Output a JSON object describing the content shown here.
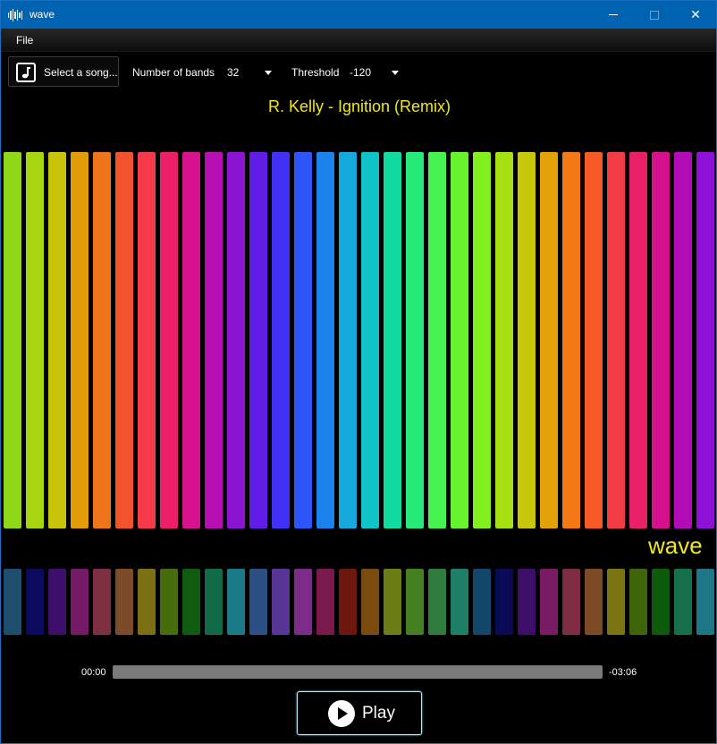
{
  "window": {
    "title": "wave"
  },
  "menu": {
    "file": "File"
  },
  "toolbar": {
    "select_song": "Select a song...",
    "bands_label": "Number of bands",
    "bands_value": "32",
    "threshold_label": "Threshold",
    "threshold_value": "-120"
  },
  "song_title": "R. Kelly - Ignition (Remix)",
  "logo": "wave",
  "playback": {
    "elapsed": "00:00",
    "remaining": "-03:06",
    "progress": 0
  },
  "play_label": "Play",
  "accent": "#f1e71a",
  "spectrum_top": [
    "#8fd719",
    "#a6d60f",
    "#c8c40a",
    "#e29c09",
    "#f0741a",
    "#f2522c",
    "#f53b4a",
    "#ec1f68",
    "#d8128c",
    "#b60fb4",
    "#8b14d2",
    "#611ce8",
    "#4230f4",
    "#2d55f7",
    "#1b82ee",
    "#15a9dd",
    "#10c3c6",
    "#12dba2",
    "#28ea78",
    "#47f44f",
    "#66f42e",
    "#84ef1f",
    "#a6df12",
    "#c8c70b",
    "#e3a10a",
    "#f37816",
    "#f65a27",
    "#f23c45",
    "#e82167",
    "#d4108d",
    "#b20cb7",
    "#8f10d6"
  ],
  "spectrum_bottom": [
    "#1d4e6e",
    "#0c0a5e",
    "#3d0f6a",
    "#751a66",
    "#7e2f43",
    "#7d4a2a",
    "#7c6f14",
    "#476c0c",
    "#0f5b10",
    "#116b49",
    "#1b7a87",
    "#2c4f86",
    "#573695",
    "#7b2b88",
    "#7a1a4c",
    "#6d170e",
    "#7a4a0e",
    "#6c7d13",
    "#467f22",
    "#2f7c3e",
    "#1e7e66",
    "#12476a",
    "#0a0a57",
    "#3e0e6b",
    "#7a1b66",
    "#7e2c44",
    "#7d4a26",
    "#7a7511",
    "#3e650a",
    "#0d5a0c",
    "#167049",
    "#1e7785"
  ]
}
